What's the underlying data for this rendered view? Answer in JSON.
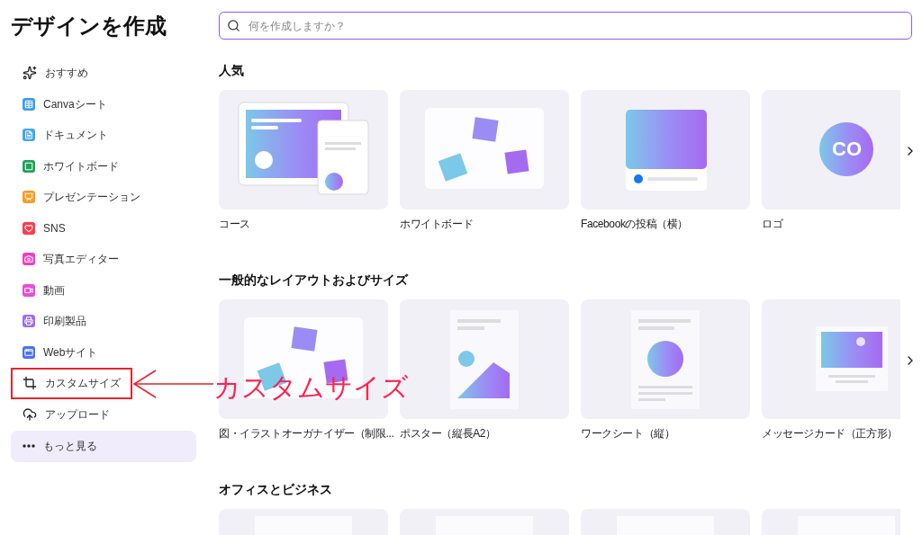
{
  "title": "デザインを作成",
  "sidebar": {
    "items": [
      {
        "label": "おすすめ",
        "kind": "item",
        "annotated": false
      },
      {
        "label": "Canvaシート",
        "kind": "item",
        "annotated": false
      },
      {
        "label": "ドキュメント",
        "kind": "item",
        "annotated": false
      },
      {
        "label": "ホワイトボード",
        "kind": "item",
        "annotated": false
      },
      {
        "label": "プレゼンテーション",
        "kind": "item",
        "annotated": false
      },
      {
        "label": "SNS",
        "kind": "item",
        "annotated": false
      },
      {
        "label": "写真エディター",
        "kind": "item",
        "annotated": false
      },
      {
        "label": "動画",
        "kind": "item",
        "annotated": false
      },
      {
        "label": "印刷製品",
        "kind": "item",
        "annotated": false
      },
      {
        "label": "Webサイト",
        "kind": "item",
        "annotated": false
      },
      {
        "label": "カスタムサイズ",
        "kind": "item",
        "annotated": true
      },
      {
        "label": "アップロード",
        "kind": "item",
        "annotated": false
      },
      {
        "label": "もっと見る",
        "kind": "more",
        "annotated": false
      }
    ]
  },
  "search": {
    "placeholder": "何を作成しますか？"
  },
  "sections": [
    {
      "heading": "人気",
      "cards": [
        {
          "label": "コース",
          "kind": "course"
        },
        {
          "label": "ホワイトボード",
          "kind": "whiteboard"
        },
        {
          "label": "Facebookの投稿（横）",
          "kind": "post"
        },
        {
          "label": "ロゴ",
          "kind": "logo",
          "badge": "CO"
        }
      ]
    },
    {
      "heading": "一般的なレイアウトおよびサイズ",
      "cards": [
        {
          "label": "図・イラストオーガナイザー（制限...",
          "kind": "whiteboard"
        },
        {
          "label": "ポスター（縦長A2）",
          "kind": "poster"
        },
        {
          "label": "ワークシート（縦）",
          "kind": "worksheet"
        },
        {
          "label": "メッセージカード（正方形）",
          "kind": "card"
        }
      ]
    },
    {
      "heading": "オフィスとビジネス",
      "cards": [
        {
          "kind": "blank"
        },
        {
          "kind": "blank"
        },
        {
          "kind": "blank"
        },
        {
          "kind": "blank"
        }
      ]
    }
  ],
  "annotation": {
    "text": "カスタムサイズ"
  }
}
